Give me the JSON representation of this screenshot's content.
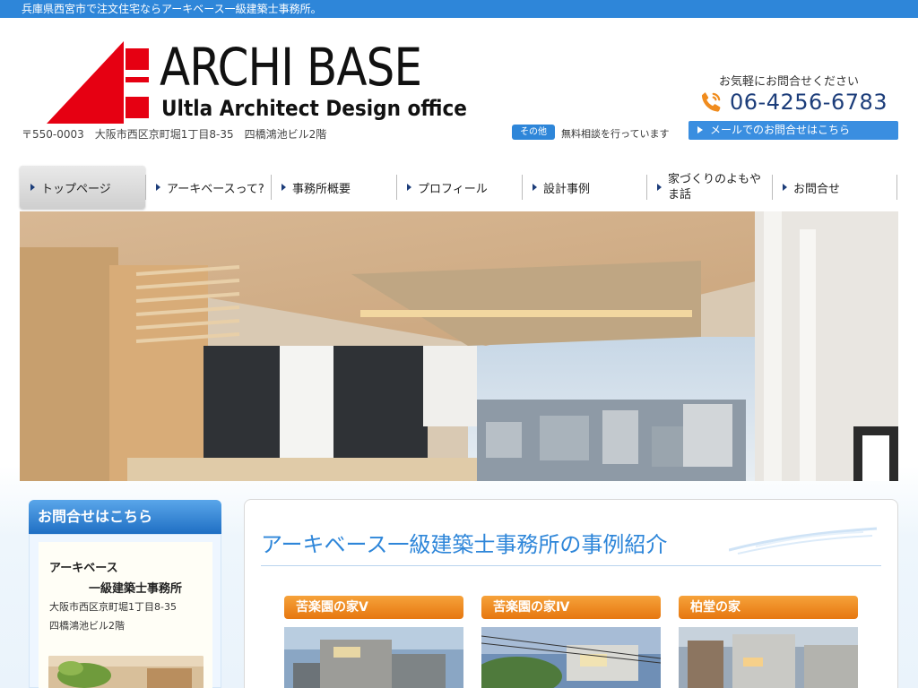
{
  "header": {
    "tagline": "兵庫県西宮市で注文住宅ならアーキベース一級建築士事務所。",
    "logo_title": "ARCHI BASE",
    "logo_subtitle": "Ultla Architect Design office",
    "address": "〒550-0003　大阪市西区京町堀1丁目8-35　四橋鴻池ビル2階",
    "contact_prompt": "お気軽にお問合せください",
    "phone": "06-4256-6783",
    "badge": "その他",
    "consult_text": "無料相談を行っています",
    "mail_button": "メールでのお問合せはこちら",
    "colors": {
      "brand_red": "#e60012",
      "accent_blue": "#2e86d9",
      "phone_navy": "#1c3d7a"
    }
  },
  "nav": {
    "items": [
      {
        "label": "トップページ",
        "active": true
      },
      {
        "label": "アーキベースって?",
        "active": false
      },
      {
        "label": "事務所概要",
        "active": false
      },
      {
        "label": "プロフィール",
        "active": false
      },
      {
        "label": "設計事例",
        "active": false
      },
      {
        "label": "家づくりのよもやま話",
        "active": false
      },
      {
        "label": "お問合せ",
        "active": false
      }
    ]
  },
  "sidebar": {
    "heading": "お問合せはこちら",
    "name_line1": "アーキベース",
    "name_line2": "一級建築士事務所",
    "address_line1": "大阪市西区京町堀1丁目8-35",
    "address_line2": "四橋鴻池ビル2階"
  },
  "main": {
    "title": "アーキベース一級建築士事務所の事例紹介",
    "cases": [
      {
        "label": "苦楽園の家Ⅴ"
      },
      {
        "label": "苦楽園の家Ⅳ"
      },
      {
        "label": "柏堂の家"
      }
    ],
    "case_color": "#f08c1e"
  },
  "icons": {
    "phone": "phone-icon",
    "mail_arrow": "arrow-right-icon",
    "nav_bullet": "triangle-bullet-icon"
  }
}
